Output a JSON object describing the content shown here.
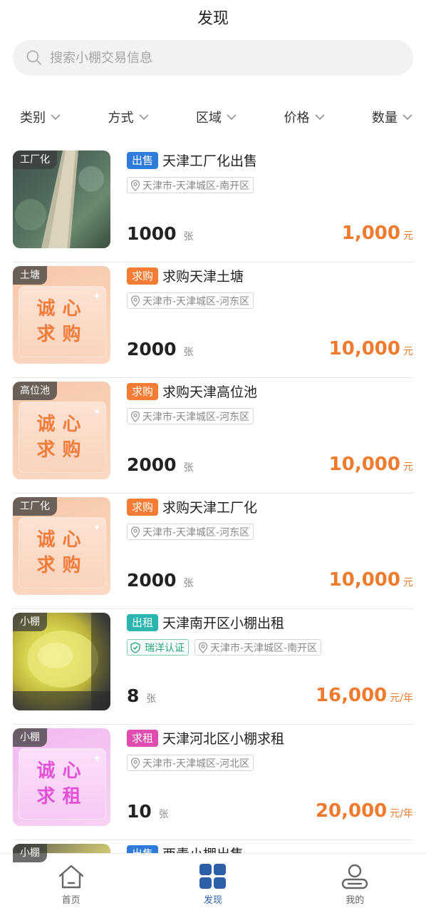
{
  "header": {
    "title": "发现"
  },
  "search": {
    "placeholder": "搜索小棚交易信息"
  },
  "filters": [
    {
      "label": "类别"
    },
    {
      "label": "方式"
    },
    {
      "label": "区域"
    },
    {
      "label": "价格"
    },
    {
      "label": "数量"
    }
  ],
  "listings": [
    {
      "thumb_tag": "工厂化",
      "thumb_type": "photo",
      "type": "出售",
      "type_color": "#2f7bdc",
      "title": "天津工厂化出售",
      "location": "天津市-天津城区-南开区",
      "qty": "1000",
      "qty_unit": "张",
      "price": "1,000",
      "price_unit": "元"
    },
    {
      "thumb_tag": "土塘",
      "thumb_type": "promo",
      "promo_line1": "诚心",
      "promo_line2": "求购",
      "type": "求购",
      "type_color": "#f57c35",
      "title": "求购天津土塘",
      "location": "天津市-天津城区-河东区",
      "qty": "2000",
      "qty_unit": "张",
      "price": "10,000",
      "price_unit": "元"
    },
    {
      "thumb_tag": "高位池",
      "thumb_type": "promo",
      "promo_line1": "诚心",
      "promo_line2": "求购",
      "type": "求购",
      "type_color": "#f57c35",
      "title": "求购天津高位池",
      "location": "天津市-天津城区-河东区",
      "qty": "2000",
      "qty_unit": "张",
      "price": "10,000",
      "price_unit": "元"
    },
    {
      "thumb_tag": "工厂化",
      "thumb_type": "promo",
      "promo_line1": "诚心",
      "promo_line2": "求购",
      "type": "求购",
      "type_color": "#f57c35",
      "title": "求购天津工厂化",
      "location": "天津市-天津城区-河东区",
      "qty": "2000",
      "qty_unit": "张",
      "price": "10,000",
      "price_unit": "元"
    },
    {
      "thumb_tag": "小棚",
      "thumb_type": "photo",
      "type": "出租",
      "type_color": "#2ab5b0",
      "title": "天津南开区小棚出租",
      "certification": "瑞洋认证",
      "location": "天津市-天津城区-南开区",
      "qty": "8",
      "qty_unit": "张",
      "price": "16,000",
      "price_unit": "元/年"
    },
    {
      "thumb_tag": "小棚",
      "thumb_type": "promo",
      "promo_line1": "诚心",
      "promo_line2": "求租",
      "type": "求租",
      "type_color": "#e04cb0",
      "title": "天津河北区小棚求租",
      "location": "天津市-天津城区-河北区",
      "qty": "10",
      "qty_unit": "张",
      "price": "20,000",
      "price_unit": "元/年"
    },
    {
      "thumb_tag": "小棚",
      "thumb_type": "photo",
      "type": "出售",
      "type_color": "#2f7bdc",
      "title": "西青小棚出售"
    }
  ],
  "tabbar": [
    {
      "label": "首页",
      "icon": "home-icon"
    },
    {
      "label": "发现",
      "icon": "discover-icon",
      "active": true
    },
    {
      "label": "我的",
      "icon": "profile-icon"
    }
  ]
}
